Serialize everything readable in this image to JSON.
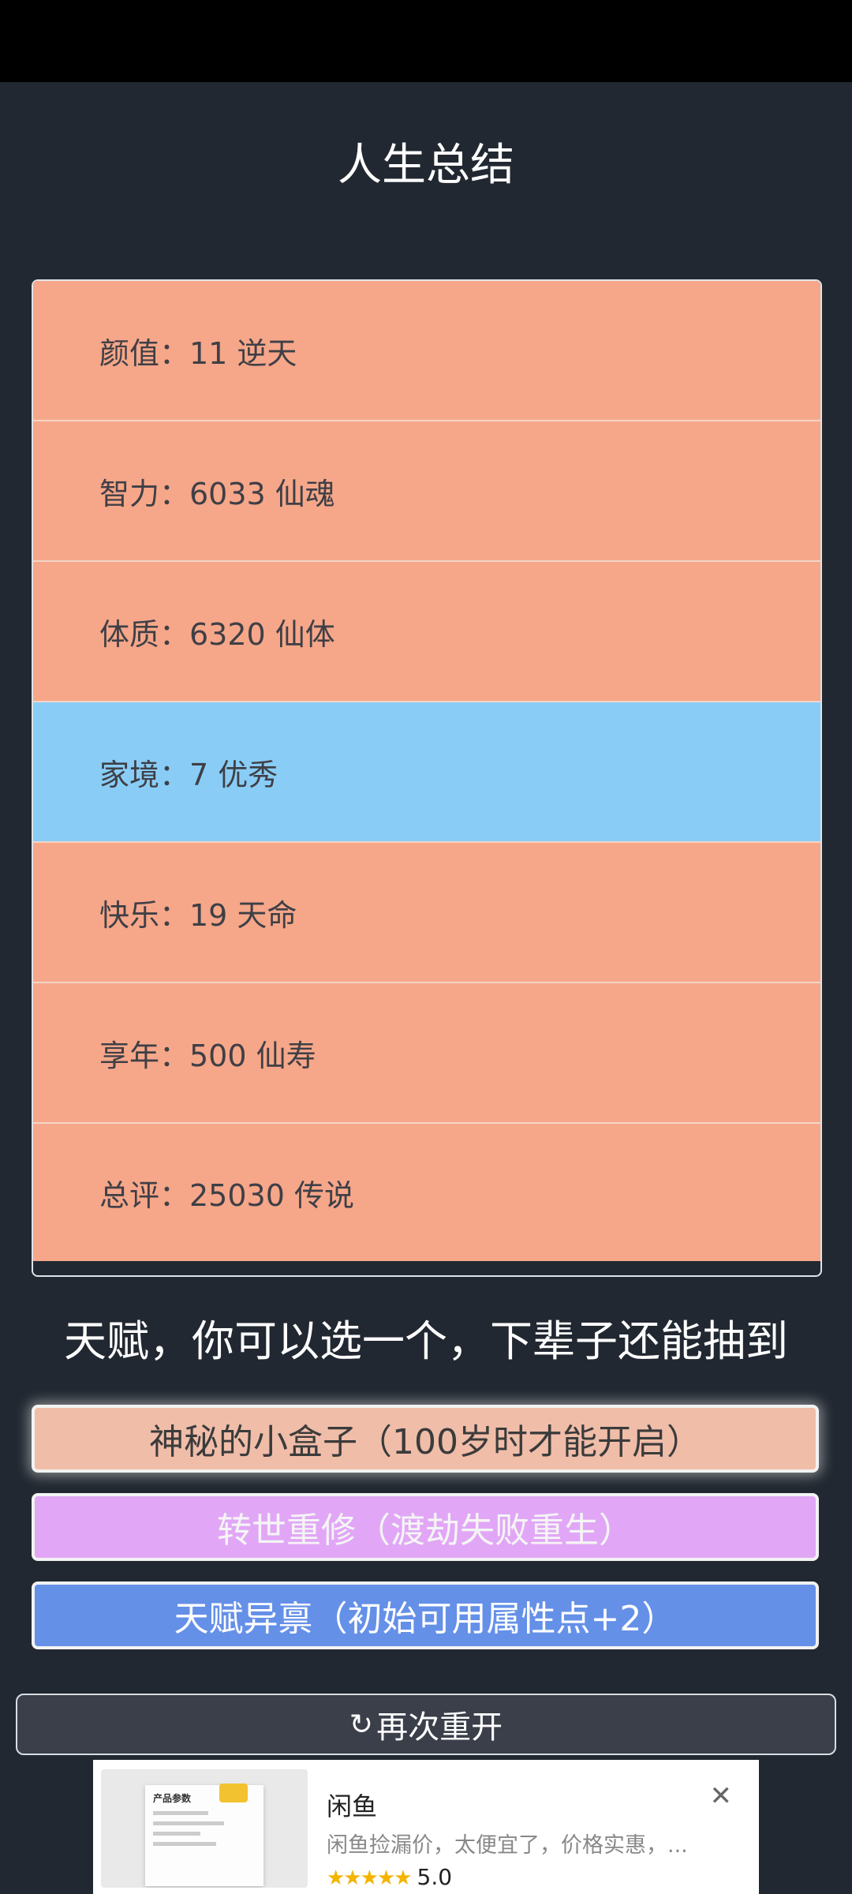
{
  "header": {
    "title": "人生总结"
  },
  "summary": {
    "rows": [
      {
        "label": "颜值：11 逆天"
      },
      {
        "label": "智力：6033 仙魂"
      },
      {
        "label": "体质：6320 仙体"
      },
      {
        "label": "家境：7 优秀"
      },
      {
        "label": "快乐：19 天命"
      },
      {
        "label": "享年：500 仙寿"
      },
      {
        "label": "总评：25030 传说"
      }
    ]
  },
  "talents": {
    "heading": "天赋，你可以选一个，下辈子还能抽到",
    "options": [
      {
        "label": "神秘的小盒子（100岁时才能开启）"
      },
      {
        "label": "转世重修（渡劫失败重生）"
      },
      {
        "label": "天赋异禀（初始可用属性点+2）"
      }
    ]
  },
  "restart": {
    "icon": "refresh-icon",
    "label": "再次重开"
  },
  "ad": {
    "thumb_title": "产品参数",
    "title": "闲鱼",
    "description": "闲鱼捡漏价，太便宜了，价格实惠，...",
    "stars": "★★★★★",
    "rating": "5.0",
    "close_icon": "close-icon"
  },
  "colors": {
    "background": "#222831",
    "row_orange": "#f6a789",
    "row_blue": "#89cdf6",
    "talent_1": "#f0bda9",
    "talent_2": "#e1a7f6",
    "talent_3": "#6590e8"
  }
}
